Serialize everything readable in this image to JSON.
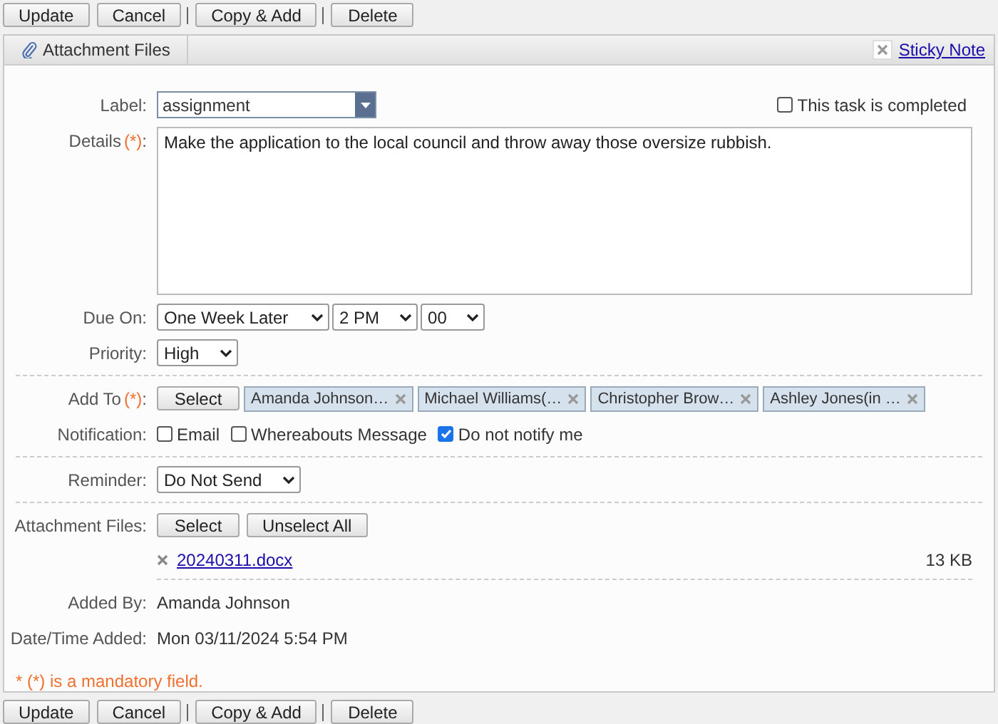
{
  "toolbar_top": {
    "groups": [
      [
        "Update",
        "Cancel"
      ],
      [
        "Copy & Add"
      ],
      [
        "Delete"
      ]
    ]
  },
  "tab": {
    "label": "Attachment Files"
  },
  "sticky_note": {
    "label": "Sticky Note"
  },
  "sections": [
    [
      {
        "kind": "label_select",
        "label": "Label:",
        "value": "assignment",
        "completed": {
          "label": "This task is completed",
          "checked": false
        }
      },
      {
        "kind": "textarea",
        "label": "Details",
        "mark": "(*)",
        "suffix": ":",
        "value": "Make the application to the local council and throw away those oversize rubbish."
      },
      {
        "kind": "selects",
        "label": "Due On:",
        "selects": [
          "One Week Later",
          "2 PM",
          "00"
        ]
      },
      {
        "kind": "selects",
        "label": "Priority:",
        "selects": [
          "High"
        ]
      }
    ],
    [
      {
        "kind": "tags",
        "label": "Add To",
        "mark": "(*)",
        "suffix": ":",
        "button": "Select",
        "tags": [
          "Amanda Johnson…",
          "Michael Williams(…",
          "Christopher Brow…",
          "Ashley Jones(in …"
        ]
      },
      {
        "kind": "checks",
        "label": "Notification:",
        "options": [
          {
            "label": "Email",
            "checked": false
          },
          {
            "label": "Whereabouts Message",
            "checked": false
          },
          {
            "label": "Do not notify me",
            "checked": true
          }
        ]
      }
    ],
    [
      {
        "kind": "selects",
        "label": "Reminder:",
        "selects": [
          "Do Not Send"
        ]
      }
    ],
    [
      {
        "kind": "files",
        "label": "Attachment Files:",
        "buttons": [
          "Select",
          "Unselect All"
        ],
        "files": [
          {
            "name": "20240311.docx",
            "size": "13 KB"
          }
        ]
      },
      {
        "kind": "text",
        "label": "Added By:",
        "value": "Amanda Johnson"
      },
      {
        "kind": "text",
        "label": "Date/Time Added:",
        "value": "Mon 03/11/2024 5:54 PM"
      }
    ]
  ],
  "mandatory_note": "* (*) is a mandatory field.",
  "toolbar_bottom": {
    "groups": [
      [
        "Update",
        "Cancel"
      ],
      [
        "Copy & Add"
      ],
      [
        "Delete"
      ]
    ]
  }
}
